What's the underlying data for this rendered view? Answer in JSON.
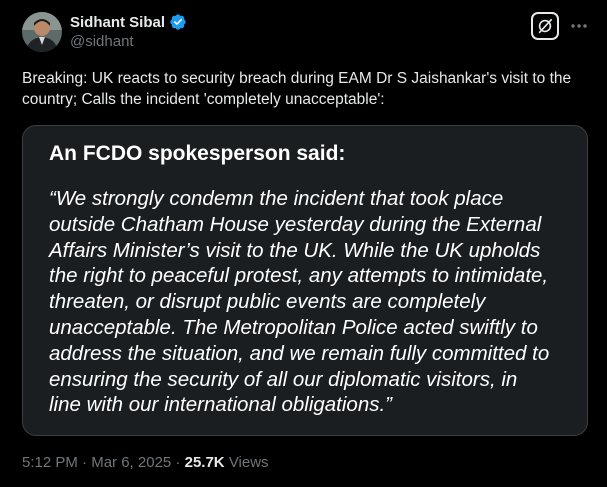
{
  "author": {
    "name": "Sidhant Sibal",
    "handle": "@sidhant",
    "verified": true
  },
  "post": {
    "text": "Breaking: UK reacts to security breach during EAM Dr S Jaishankar's visit to the country; Calls the incident 'completely unacceptable':"
  },
  "quote_card": {
    "heading": "An FCDO spokesperson said:",
    "lines": [
      "“We strongly condemn the incident that took place",
      "outside Chatham House yesterday during the External",
      "Affairs Minister’s visit to the UK. While the UK upholds",
      "the right to peaceful protest, any attempts to intimidate,",
      "threaten, or disrupt public events are completely",
      "unacceptable. The Metropolitan Police acted swiftly to",
      "address the situation, and we remain fully committed to",
      "ensuring the security of all our diplomatic visitors, in",
      "line with our international obligations.”"
    ]
  },
  "meta": {
    "time": "5:12 PM",
    "separator": " · ",
    "date": "Mar 6, 2025",
    "views_count": "25.7K",
    "views_label": "Views"
  },
  "icons": {
    "verified": "verified-badge-icon",
    "grok": "grok-icon",
    "more": "more-options-icon"
  },
  "colors": {
    "background": "#000000",
    "primary_text": "#e7e9ea",
    "secondary_text": "#71767b",
    "verified_blue": "#1d9bf0",
    "card_background": "#1b1e21"
  }
}
